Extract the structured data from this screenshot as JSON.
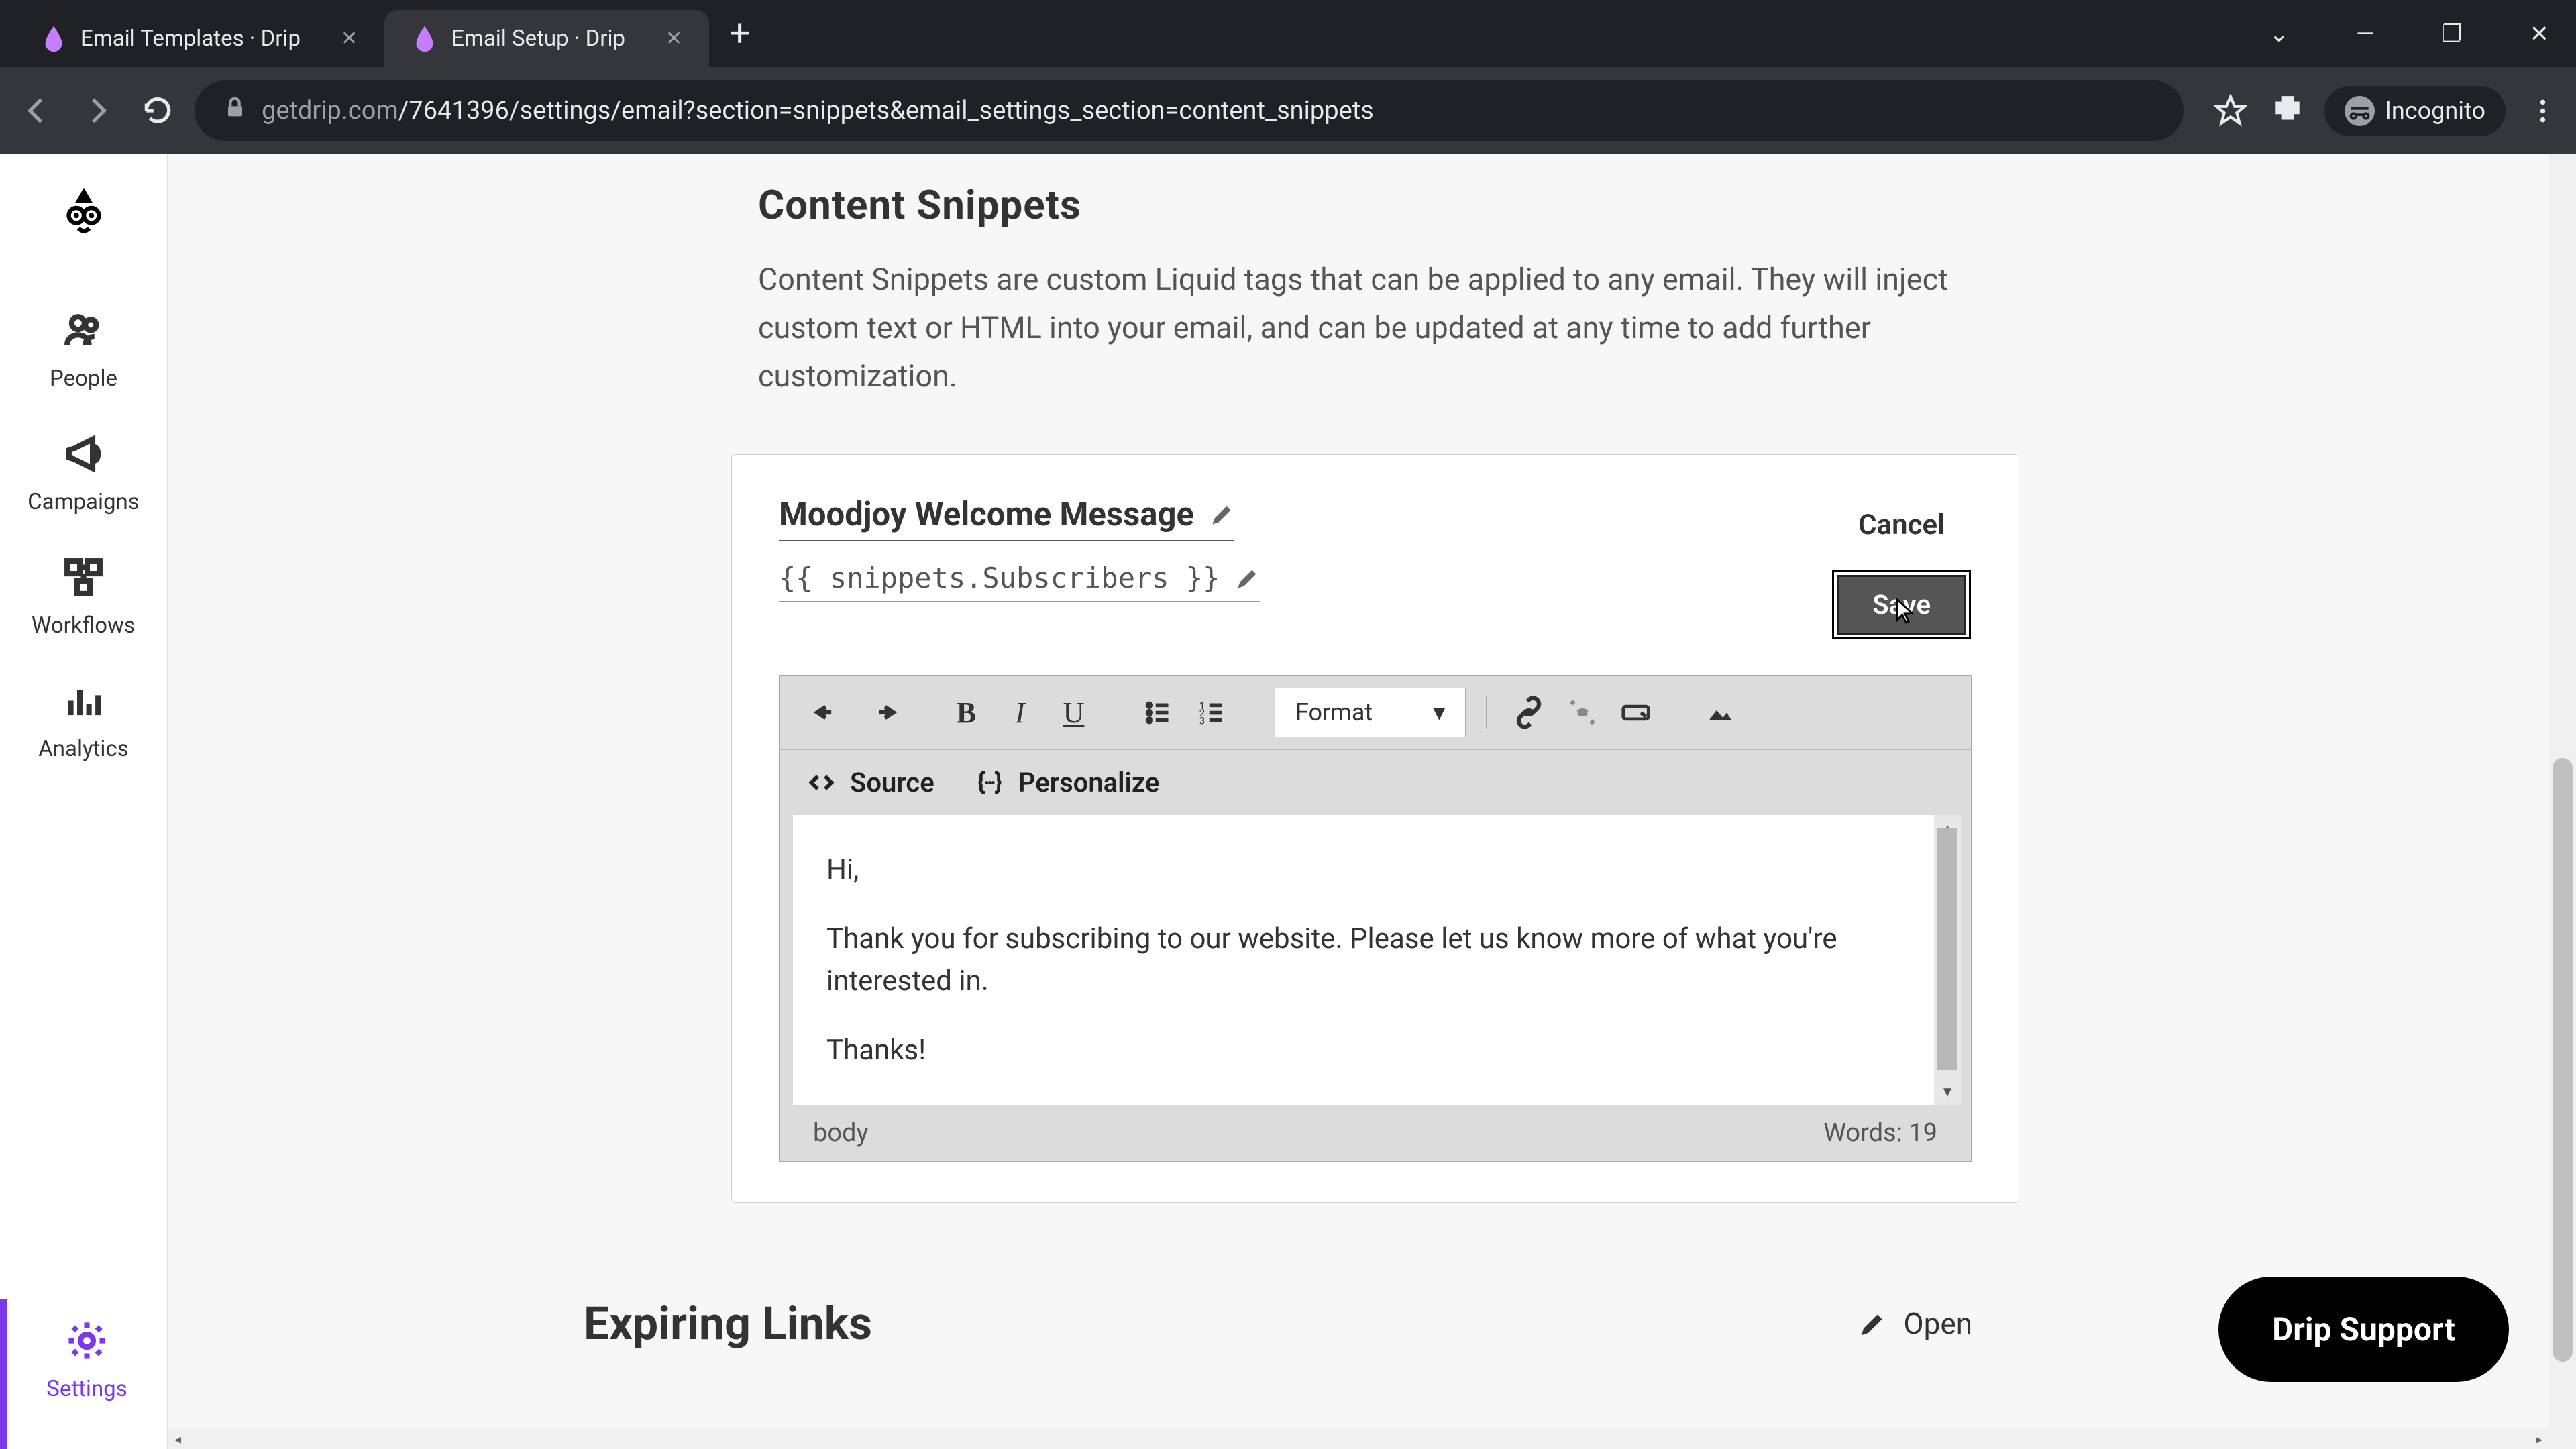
{
  "browser": {
    "tabs": [
      {
        "title": "Email Templates · Drip",
        "active": false
      },
      {
        "title": "Email Setup · Drip",
        "active": true
      }
    ],
    "url_gray1": "getdrip.com",
    "url_path": "/7641396/settings/email?section=snippets&email_settings_section=content_snippets",
    "incognito": "Incognito"
  },
  "sidebar": {
    "items": [
      {
        "label": "People",
        "icon": "people-icon"
      },
      {
        "label": "Campaigns",
        "icon": "megaphone-icon"
      },
      {
        "label": "Workflows",
        "icon": "workflow-icon"
      },
      {
        "label": "Analytics",
        "icon": "analytics-icon"
      }
    ],
    "bottom": {
      "label": "Settings",
      "icon": "gear-icon"
    }
  },
  "content_snippets": {
    "title": "Content Snippets",
    "description": "Content Snippets are custom Liquid tags that can be applied to any email. They will inject custom text or HTML into your email, and can be updated at any time to add further customization.",
    "snippet": {
      "name": "Moodjoy Welcome Message",
      "tag": "{{ snippets.Subscribers }}",
      "cancel": "Cancel",
      "save": "Save",
      "toolbar": {
        "format": "Format",
        "source": "Source",
        "personalize": "Personalize"
      },
      "body_lines": [
        "Hi,",
        "Thank you for subscribing to our website. Please let us know more of what you're interested in.",
        "Thanks!"
      ],
      "footer_path": "body",
      "footer_words": "Words: 19"
    }
  },
  "expiring_links": {
    "title": "Expiring Links",
    "open": "Open"
  },
  "support": {
    "label": "Drip Support"
  }
}
